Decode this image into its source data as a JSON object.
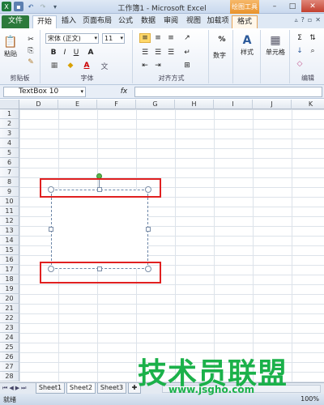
{
  "titlebar": {
    "title": "工作簿1 - Microsoft Excel",
    "context_tool": "绘图工具",
    "qat": [
      "save",
      "undo",
      "redo"
    ]
  },
  "tabs": {
    "file": "文件",
    "items": [
      "开始",
      "插入",
      "页面布局",
      "公式",
      "数据",
      "审阅",
      "视图",
      "加载项",
      "格式"
    ],
    "active": "开始"
  },
  "ribbon": {
    "clipboard": {
      "paste": "粘贴",
      "label": "剪贴板"
    },
    "font": {
      "name": "宋体 (正文)",
      "size": "11",
      "label": "字体",
      "bold": "B",
      "italic": "I",
      "underline": "U",
      "grow": "A",
      "color_letter": "A",
      "phonetic": "文"
    },
    "alignment": {
      "label": "对齐方式"
    },
    "number": {
      "label": "数字",
      "percent": "%"
    },
    "styles": {
      "label": "样式"
    },
    "cells": {
      "label": "单元格"
    },
    "editing": {
      "label": "编辑",
      "sum": "Σ"
    }
  },
  "formula_bar": {
    "name_box": "TextBox 10",
    "fx": "fx",
    "value": ""
  },
  "grid": {
    "columns": [
      "D",
      "E",
      "F",
      "G",
      "H",
      "I",
      "J",
      "K"
    ],
    "rows": [
      "1",
      "2",
      "3",
      "4",
      "5",
      "6",
      "7",
      "8",
      "9",
      "10",
      "11",
      "12",
      "13",
      "14",
      "15",
      "16",
      "17",
      "18",
      "19",
      "20",
      "21",
      "22",
      "23",
      "24",
      "25",
      "26",
      "27",
      "28"
    ]
  },
  "sheets": {
    "tabs": [
      "Sheet1",
      "Sheet2",
      "Sheet3"
    ],
    "active": "Sheet2"
  },
  "status": {
    "text": "就绪",
    "zoom_label": "100%"
  },
  "watermark": {
    "cn": "技术员联盟",
    "url": "www.jsgho.com"
  },
  "colors": {
    "file_tab": "#2c7a3b",
    "context_tool": "#e9922b",
    "highlight_box": "#e02020",
    "rotation_handle": "#59b34a",
    "watermark": "#1bb14a"
  }
}
